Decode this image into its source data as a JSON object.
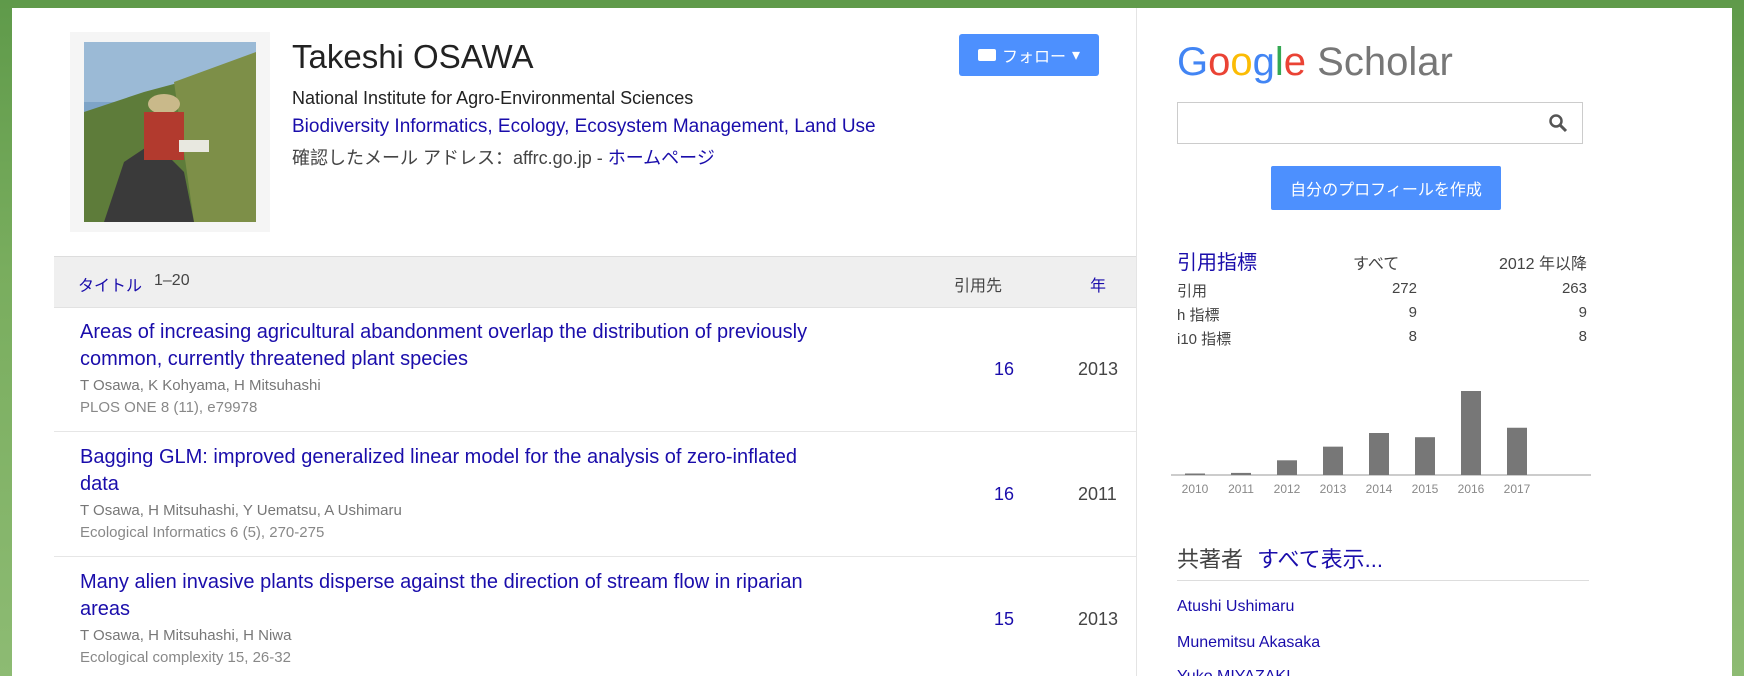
{
  "profile": {
    "name": "Takeshi OSAWA",
    "affiliation": "National Institute for Agro-Environmental Sciences",
    "interests": "Biodiversity Informatics, Ecology, Ecosystem Management, Land Use",
    "email_prefix": "確認したメール アドレス：affrc.go.jp - ",
    "homepage": "ホームページ",
    "follow_label": "フォロー"
  },
  "table": {
    "title_header": "タイトル",
    "range": "1–20",
    "cited_header": "引用先",
    "year_header": "年",
    "rows": [
      {
        "title": "Areas of increasing agricultural abandonment overlap the distribution of previously common, currently threatened plant species",
        "authors": "T Osawa, K Kohyama, H Mitsuhashi",
        "venue": "PLOS ONE 8 (11), e79978",
        "cited": "16",
        "year": "2013"
      },
      {
        "title": "Bagging GLM: improved generalized linear model for the analysis of zero-inflated data",
        "authors": "T Osawa, H Mitsuhashi, Y Uematsu, A Ushimaru",
        "venue": "Ecological Informatics 6 (5), 270-275",
        "cited": "16",
        "year": "2011"
      },
      {
        "title": "Many alien invasive plants disperse against the direction of stream flow in riparian areas",
        "authors": "T Osawa, H Mitsuhashi, H Niwa",
        "venue": "Ecological complexity 15, 26-32",
        "cited": "15",
        "year": "2013"
      }
    ]
  },
  "sidebar": {
    "logo_google": [
      "G",
      "o",
      "o",
      "g",
      "l",
      "e"
    ],
    "logo_scholar": "Scholar",
    "search_placeholder": "",
    "create_profile": "自分のプロフィールを作成",
    "metrics": {
      "title": "引用指標",
      "col_all": "すべて",
      "col_since": "2012 年以降",
      "rows": [
        {
          "label": "引用",
          "all": "272",
          "since": "263"
        },
        {
          "label": "h 指標",
          "all": "9",
          "since": "9"
        },
        {
          "label": "i10 指標",
          "all": "8",
          "since": "8"
        }
      ]
    },
    "coauthors_title": "共著者",
    "coauthors_link": "すべて表示...",
    "coauthors": [
      "Atushi Ushimaru",
      "Munemitsu Akasaka",
      "Yuko MIYAZAKI"
    ]
  },
  "chart_data": {
    "type": "bar",
    "categories": [
      "2010",
      "2011",
      "2012",
      "2013",
      "2014",
      "2015",
      "2016",
      "2017"
    ],
    "values": [
      1,
      2,
      14,
      27,
      40,
      36,
      80,
      45
    ],
    "color": "#777777"
  }
}
